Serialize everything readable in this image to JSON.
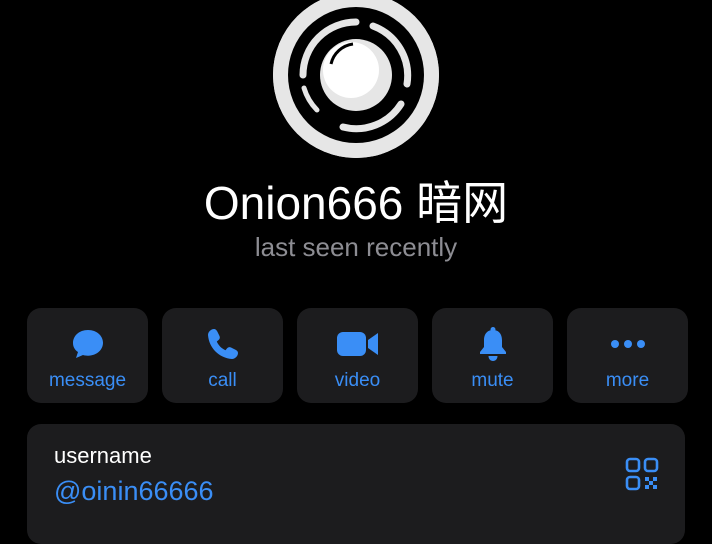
{
  "profile": {
    "name": "Onion666 暗网",
    "status": "last seen recently"
  },
  "actions": [
    {
      "label": "message",
      "icon": "message-bubble-icon"
    },
    {
      "label": "call",
      "icon": "phone-icon"
    },
    {
      "label": "video",
      "icon": "video-camera-icon"
    },
    {
      "label": "mute",
      "icon": "bell-icon"
    },
    {
      "label": "more",
      "icon": "ellipsis-icon"
    }
  ],
  "info": {
    "username_label": "username",
    "username_value": "@oinin66666",
    "qr_icon": "qr-code-icon"
  },
  "colors": {
    "background": "#000000",
    "card": "#1c1c1e",
    "accent": "#3a8ef6",
    "secondary_text": "#8d8d93"
  }
}
